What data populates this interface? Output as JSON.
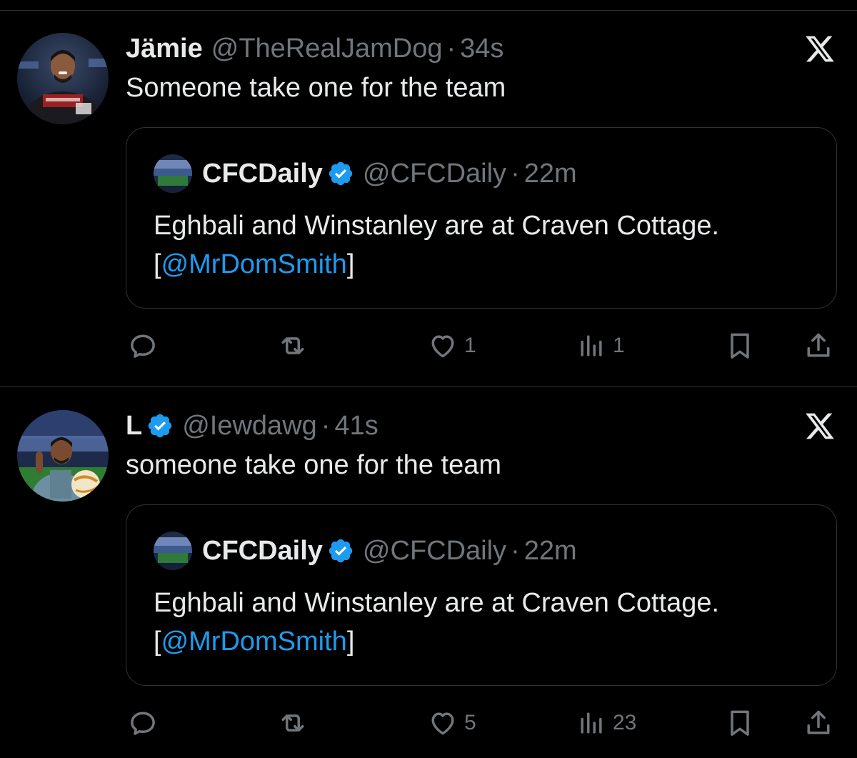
{
  "colors": {
    "background": "#000000",
    "primary_text": "#e7e9ea",
    "secondary_text": "#71767b",
    "divider": "#2f3336",
    "accent": "#1d9bf0"
  },
  "tweets": [
    {
      "display_name": "Jämie",
      "verified": false,
      "handle": "@TheRealJamDog",
      "separator": "·",
      "time": "34s",
      "text": "Someone take one for the team",
      "platform_icon": "x-logo-icon",
      "avatar_icon": "user-avatar-icon",
      "quote": {
        "display_name": "CFCDaily",
        "verified": true,
        "handle": "@CFCDaily",
        "separator": "·",
        "time": "22m",
        "text_before": "Eghbali and Winstanley are at Craven Cottage.",
        "bracket_open": "[",
        "mention": "@MrDomSmith",
        "bracket_close": "]"
      },
      "actions": {
        "reply_count": "",
        "retweet_count": "",
        "like_count": "1",
        "views_count": "1"
      }
    },
    {
      "display_name": "L",
      "verified": true,
      "handle": "@Iewdawg",
      "separator": "·",
      "time": "41s",
      "text": "someone take one for the team",
      "platform_icon": "x-logo-icon",
      "avatar_icon": "user-avatar-icon",
      "quote": {
        "display_name": "CFCDaily",
        "verified": true,
        "handle": "@CFCDaily",
        "separator": "·",
        "time": "22m",
        "text_before": "Eghbali and Winstanley are at Craven Cottage.",
        "bracket_open": "[",
        "mention": "@MrDomSmith",
        "bracket_close": "]"
      },
      "actions": {
        "reply_count": "",
        "retweet_count": "",
        "like_count": "5",
        "views_count": "23"
      }
    }
  ]
}
